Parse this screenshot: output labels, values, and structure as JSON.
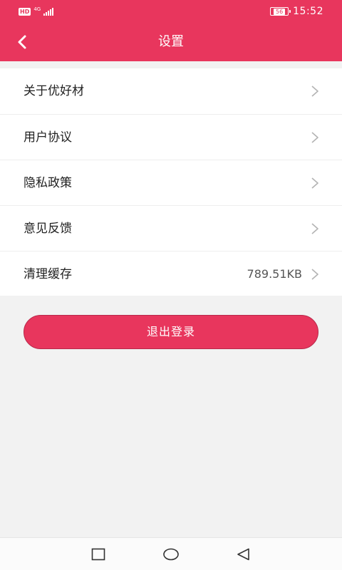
{
  "colors": {
    "accent": "#e8365d",
    "background": "#f2f2f2",
    "text": "#222222",
    "secondary_text": "#555555"
  },
  "status_bar": {
    "hd_label": "HD",
    "network": "4G",
    "battery": "56",
    "time": "15:52"
  },
  "header": {
    "back_icon": "chevron-left-icon",
    "title": "设置"
  },
  "menu": {
    "items": [
      {
        "label": "关于优好材",
        "value": ""
      },
      {
        "label": "用户协议",
        "value": ""
      },
      {
        "label": "隐私政策",
        "value": ""
      },
      {
        "label": "意见反馈",
        "value": ""
      },
      {
        "label": "清理缓存",
        "value": "789.51KB"
      }
    ]
  },
  "logout_label": "退出登录",
  "system_nav": {
    "icons": [
      "recent-apps-icon",
      "home-icon",
      "back-triangle-icon"
    ]
  }
}
